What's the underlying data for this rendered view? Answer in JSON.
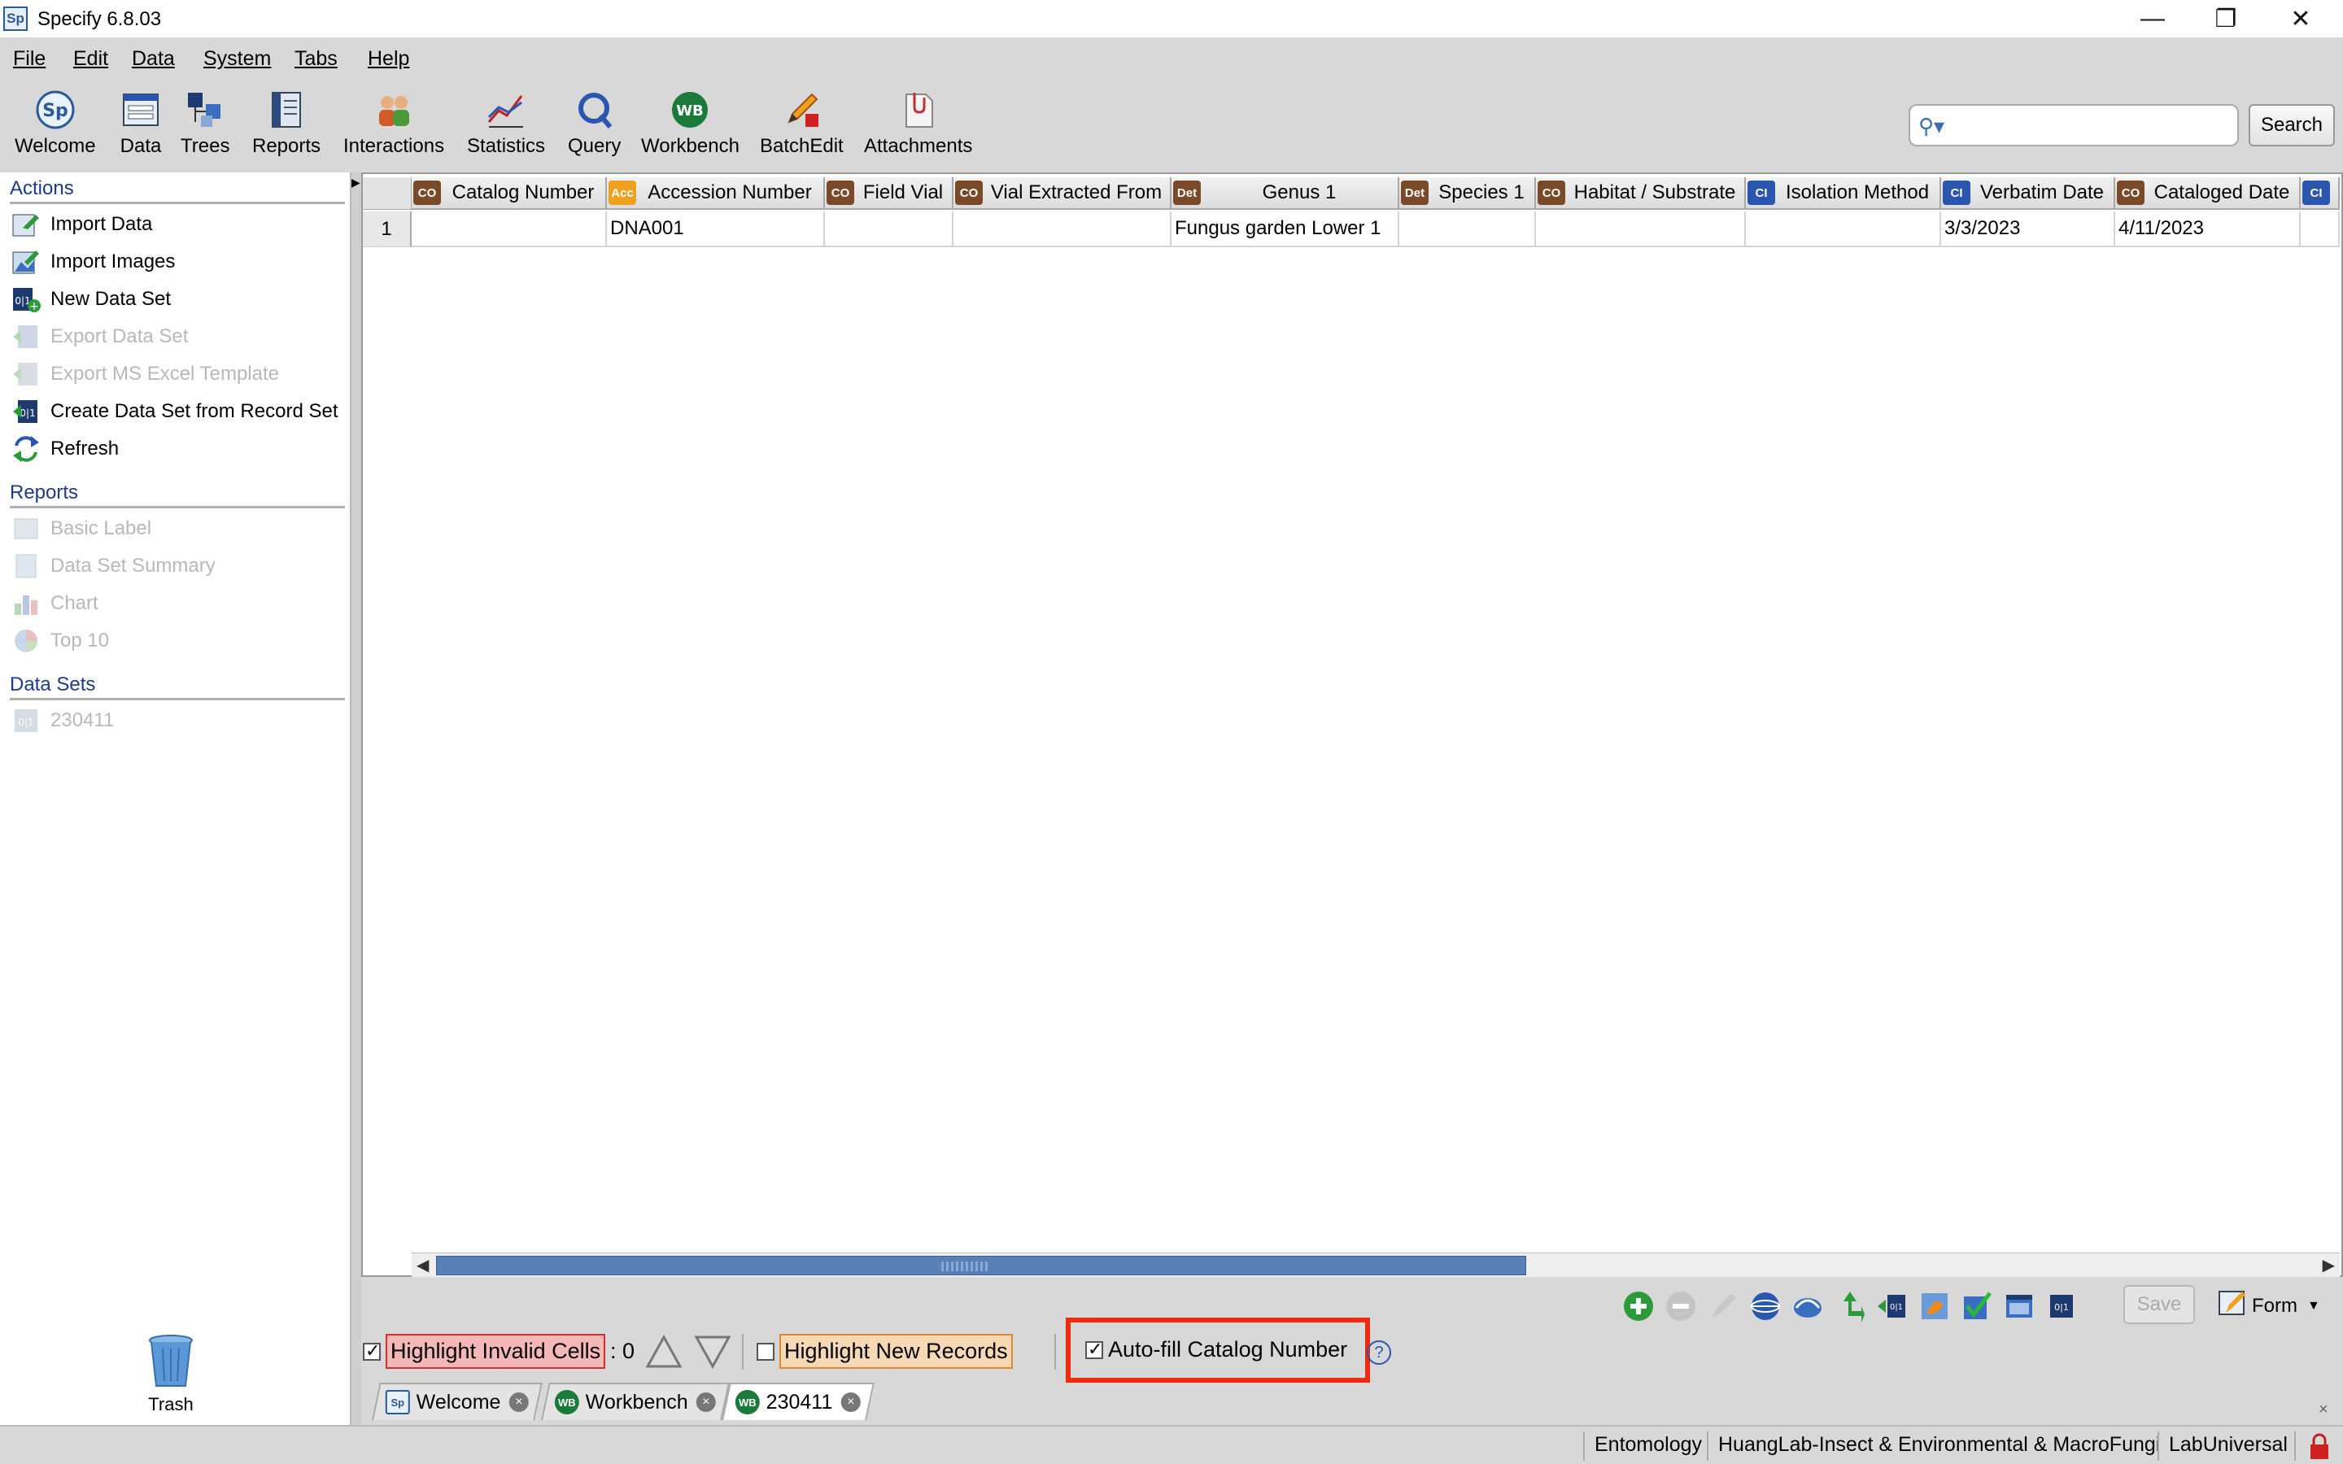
{
  "window": {
    "title": "Specify 6.8.03",
    "app_icon": "Sp",
    "minimize": "—",
    "restore": "❐",
    "close": "✕"
  },
  "menus": [
    "File",
    "Edit",
    "Data",
    "System",
    "Tabs",
    "Help"
  ],
  "toolbar": {
    "items": [
      "Welcome",
      "Data",
      "Trees",
      "Reports",
      "Interactions",
      "Statistics",
      "Query",
      "Workbench",
      "BatchEdit",
      "Attachments"
    ],
    "search_label": "Search",
    "search_placeholder": ""
  },
  "left_panel": {
    "actions_title": "Actions",
    "actions": [
      {
        "label": "Import Data",
        "enabled": true
      },
      {
        "label": "Import Images",
        "enabled": true
      },
      {
        "label": "New Data Set",
        "enabled": true
      },
      {
        "label": "Export Data Set",
        "enabled": false
      },
      {
        "label": "Export MS Excel Template",
        "enabled": false
      },
      {
        "label": "Create Data Set from Record Set",
        "enabled": true
      },
      {
        "label": "Refresh",
        "enabled": true
      }
    ],
    "reports_title": "Reports",
    "reports": [
      "Basic Label",
      "Data Set Summary",
      "Chart",
      "Top 10"
    ],
    "datasets_title": "Data Sets",
    "datasets": [
      "230411"
    ],
    "trash_label": "Trash"
  },
  "grid": {
    "columns": [
      {
        "badge": "CO",
        "label": "Catalog Number"
      },
      {
        "badge": "Acc",
        "label": "Accession Number"
      },
      {
        "badge": "CO",
        "label": "Field Vial"
      },
      {
        "badge": "CO",
        "label": "Vial Extracted From"
      },
      {
        "badge": "Det",
        "label": "Genus 1"
      },
      {
        "badge": "Det",
        "label": "Species 1"
      },
      {
        "badge": "CO",
        "label": "Habitat / Substrate"
      },
      {
        "badge": "CI",
        "label": "Isolation Method"
      },
      {
        "badge": "CI",
        "label": "Verbatim Date"
      },
      {
        "badge": "CO",
        "label": "Cataloged Date"
      },
      {
        "badge": "CI",
        "label": ""
      }
    ],
    "rows": [
      {
        "num": "1",
        "cells": [
          "",
          "DNA001",
          "",
          "",
          "Fungus garden Lower 1",
          "",
          "",
          "",
          "3/3/2023",
          "4/11/2023",
          ""
        ]
      }
    ],
    "scroll_fraction": 0.56
  },
  "bottom": {
    "highlight_invalid_label": "Highlight Invalid Cells",
    "highlight_invalid_checked": true,
    "invalid_count": ": 0",
    "highlight_new_label": "Highlight New Records",
    "highlight_new_checked": false,
    "autofill_label": "Auto-fill Catalog Number",
    "autofill_checked": true,
    "help": "?",
    "save_label": "Save",
    "form_label": "Form"
  },
  "tabs": [
    {
      "icon": "Sp",
      "label": "Welcome"
    },
    {
      "icon": "WB",
      "label": "Workbench"
    },
    {
      "icon": "WB",
      "label": "230411"
    }
  ],
  "status": {
    "discipline": "Entomology",
    "collection": "HuangLab-Insect & Environmental & MacroFungi",
    "user": "LabUniversal"
  },
  "colors": {
    "accent_blue": "#1f3a8a",
    "highlight_frame": "#ee2a10",
    "invalid_bg": "#f4b8b8",
    "new_bg": "#f6d8b4"
  }
}
